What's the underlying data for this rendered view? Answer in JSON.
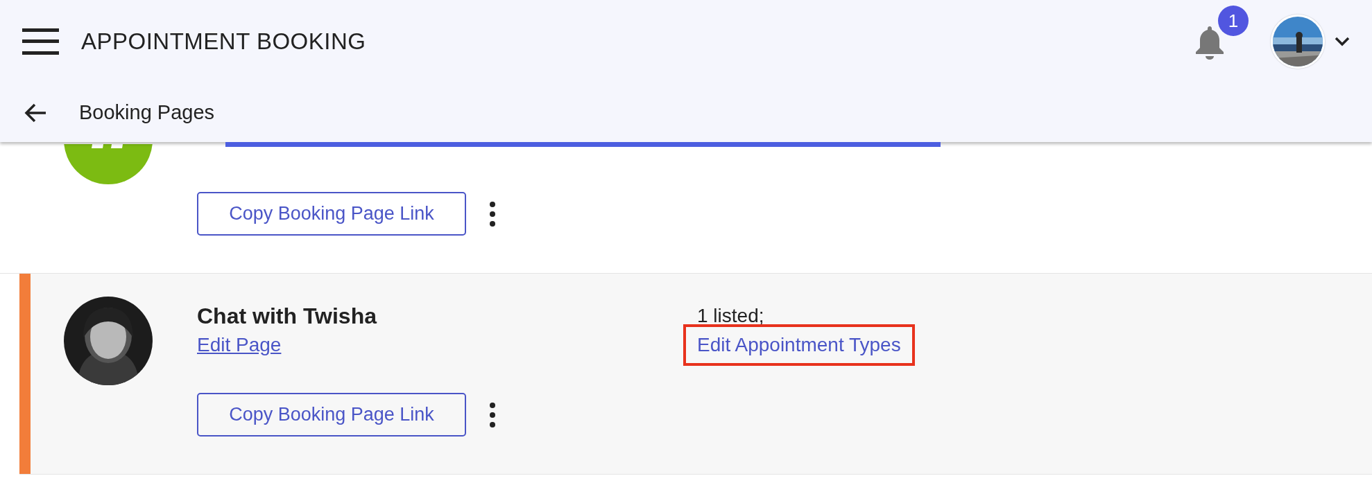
{
  "app_bar": {
    "title": "APPOINTMENT BOOKING",
    "notifications": {
      "badge": "1"
    }
  },
  "sub_bar": {
    "title": "Booking Pages"
  },
  "booking_pages": [
    {
      "kind": "logo",
      "copy_button": "Copy Booking Page Link",
      "selected": false
    },
    {
      "kind": "person",
      "name": "Chat with Twisha",
      "edit_link": "Edit Page",
      "listed": "1 listed;",
      "types_link": "Edit Appointment Types",
      "types_highlighted": true,
      "copy_button": "Copy Booking Page Link",
      "selected": true
    }
  ]
}
